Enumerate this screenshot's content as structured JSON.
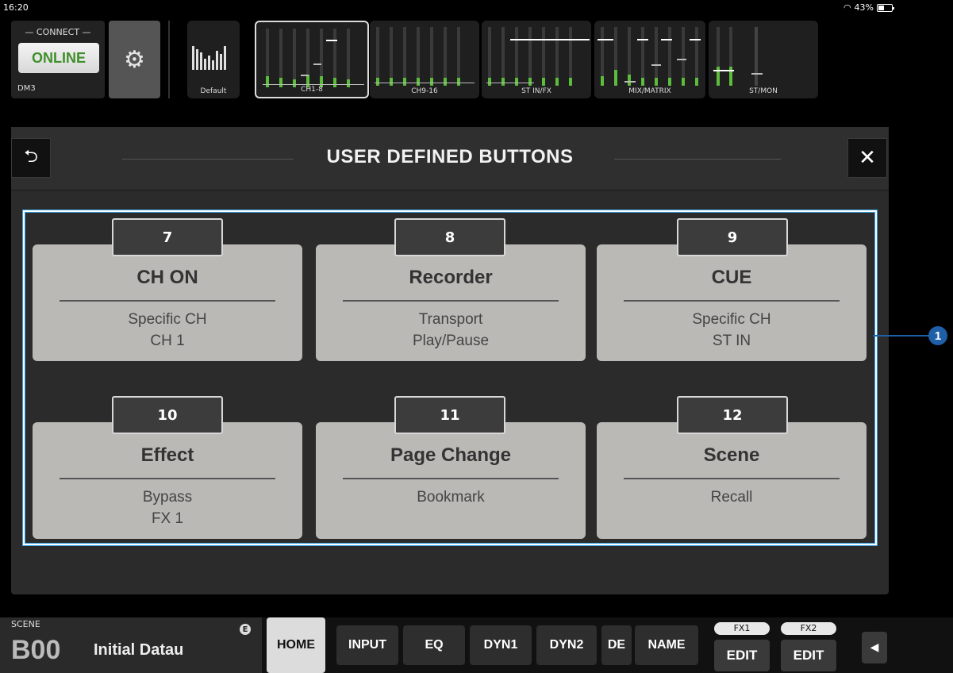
{
  "status_bar": {
    "time": "16:20",
    "battery": "43%"
  },
  "top": {
    "connect_label": "— CONNECT —",
    "online_label": "ONLINE",
    "device_name": "DM3",
    "meter_tiles": [
      {
        "label": "Default"
      },
      {
        "label": "CH1-8"
      },
      {
        "label": "CH9-16"
      },
      {
        "label": "ST IN/FX"
      },
      {
        "label": "MIX/MATRIX"
      },
      {
        "label": "ST/MON"
      }
    ]
  },
  "panel": {
    "title": "USER DEFINED BUTTONS",
    "buttons": [
      {
        "number": "7",
        "title": "CH ON",
        "line1": "Specific CH",
        "line2": "CH 1"
      },
      {
        "number": "8",
        "title": "Recorder",
        "line1": "Transport",
        "line2": "Play/Pause"
      },
      {
        "number": "9",
        "title": "CUE",
        "line1": "Specific CH",
        "line2": "ST IN"
      },
      {
        "number": "10",
        "title": "Effect",
        "line1": "Bypass",
        "line2": "FX 1"
      },
      {
        "number": "11",
        "title": "Page Change",
        "line1": "Bookmark",
        "line2": ""
      },
      {
        "number": "12",
        "title": "Scene",
        "line1": "Recall",
        "line2": ""
      }
    ],
    "callout": "1"
  },
  "bottom": {
    "scene_label": "SCENE",
    "scene_number": "B00",
    "scene_name": "Initial Datau",
    "scene_badge": "E",
    "nav": [
      "HOME",
      "INPUT",
      "EQ",
      "DYN1",
      "DYN2",
      "DE",
      "NAME"
    ],
    "fx1_label": "FX1",
    "fx2_label": "FX2",
    "edit_label": "EDIT"
  },
  "colors": {
    "meter_green": "#5bbd3a",
    "online_text": "#3f8f2a",
    "callout_blue": "#1f5fa8",
    "button_face": "#bbb9b6"
  }
}
